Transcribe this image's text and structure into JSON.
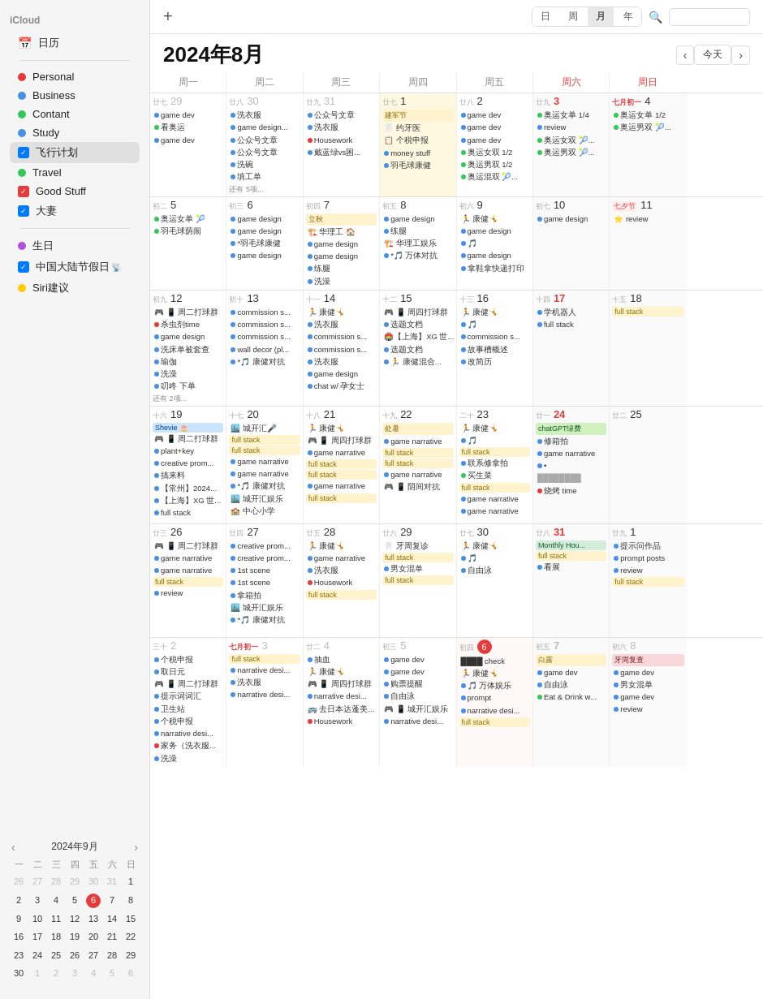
{
  "app": {
    "title": "日历",
    "cloud_label": "iCloud"
  },
  "toolbar": {
    "plus": "+",
    "views": [
      "日",
      "周",
      "月",
      "年"
    ],
    "active_view": "月",
    "today_label": "今天",
    "search_placeholder": ""
  },
  "cal_title": "2024年8月",
  "dow_headers": [
    "周一",
    "周二",
    "周三",
    "周四",
    "周五",
    "周六",
    "周日"
  ],
  "sidebar": {
    "items": [
      {
        "label": "日历",
        "type": "header"
      },
      {
        "label": "Personal",
        "color": "#e63b3b",
        "type": "dot"
      },
      {
        "label": "Business",
        "color": "#4a90e2",
        "type": "dot"
      },
      {
        "label": "Contant",
        "color": "#34c759",
        "type": "dot"
      },
      {
        "label": "Study",
        "color": "#4a90e2",
        "type": "dot"
      },
      {
        "label": "飞行计划",
        "color": "#007aff",
        "type": "check"
      },
      {
        "label": "Travel",
        "color": "#34c759",
        "type": "dot"
      },
      {
        "label": "Good Stuff",
        "color": "#e63b3b",
        "type": "check"
      },
      {
        "label": "大妻",
        "color": "#007aff",
        "type": "check"
      },
      {
        "label": "生日",
        "color": "#8e44ad",
        "type": "dot"
      },
      {
        "label": "中国大陆节假日",
        "color": "#007aff",
        "type": "check"
      },
      {
        "label": "Siri建议",
        "color": "#ffcc00",
        "type": "dot"
      }
    ]
  },
  "mini_cal": {
    "title": "2024年9月",
    "dow": [
      "一",
      "二",
      "三",
      "四",
      "五",
      "六",
      "日"
    ],
    "weeks": [
      [
        "26",
        "27",
        "28",
        "29",
        "30",
        "31",
        "1"
      ],
      [
        "2",
        "3",
        "4",
        "5",
        "6",
        "7",
        "8"
      ],
      [
        "9",
        "10",
        "11",
        "12",
        "13",
        "14",
        "15"
      ],
      [
        "16",
        "17",
        "18",
        "19",
        "20",
        "21",
        "22"
      ],
      [
        "23",
        "24",
        "25",
        "26",
        "27",
        "28",
        "29"
      ],
      [
        "30",
        "1",
        "2",
        "3",
        "4",
        "5",
        "6"
      ]
    ],
    "today": "6",
    "other_month_start": [
      "26",
      "27",
      "28",
      "29",
      "30",
      "31"
    ],
    "other_month_end": [
      "1",
      "2",
      "3",
      "4",
      "5",
      "6"
    ]
  }
}
